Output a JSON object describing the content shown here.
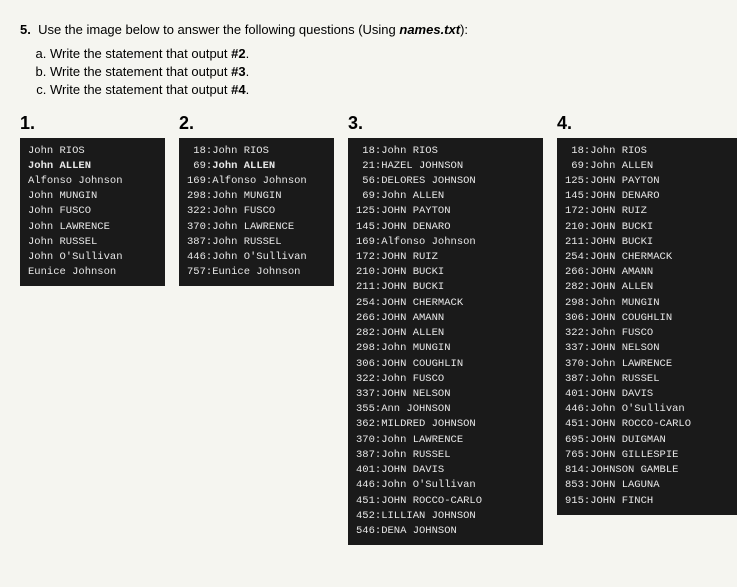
{
  "question": {
    "number": "5.",
    "text": "Use the image below to answer the following questions (Using ",
    "file_italic": "names.txt",
    "text_end": "):",
    "subquestions": [
      {
        "letter": "a.",
        "text": "Write the statement that output #2."
      },
      {
        "letter": "b.",
        "text": "Write the statement that output #3."
      },
      {
        "letter": "c.",
        "text": "Write the statement that output #4."
      }
    ]
  },
  "panels": [
    {
      "id": "panel1",
      "label": "1.",
      "lines": [
        {
          "bold": false,
          "text": "John RIOS"
        },
        {
          "bold": true,
          "text": "John ALLEN"
        },
        {
          "bold": false,
          "text": "Alfonso Johnson"
        },
        {
          "bold": false,
          "text": "John MUNGIN"
        },
        {
          "bold": false,
          "text": "John FUSCO"
        },
        {
          "bold": false,
          "text": "John LAWRENCE"
        },
        {
          "bold": false,
          "text": "John RUSSEL"
        },
        {
          "bold": false,
          "text": "John O'Sullivan"
        },
        {
          "bold": false,
          "text": "Eunice Johnson"
        }
      ]
    },
    {
      "id": "panel2",
      "label": "2.",
      "lines": [
        {
          "prefix": "18:",
          "bold": false,
          "name": "John RIOS"
        },
        {
          "prefix": "69:",
          "bold": true,
          "name": "John ALLEN"
        },
        {
          "prefix": "169:",
          "bold": false,
          "name": "Alfonso Johnson"
        },
        {
          "prefix": "298:",
          "bold": false,
          "name": "John MUNGIN"
        },
        {
          "prefix": "322:",
          "bold": false,
          "name": "John FUSCO"
        },
        {
          "prefix": "370:",
          "bold": false,
          "name": "John LAWRENCE"
        },
        {
          "prefix": "387:",
          "bold": false,
          "name": "John RUSSEL"
        },
        {
          "prefix": "446:",
          "bold": false,
          "name": "John O'Sullivan"
        },
        {
          "prefix": "757:",
          "bold": false,
          "name": "Eunice Johnson"
        }
      ]
    },
    {
      "id": "panel3",
      "label": "3.",
      "lines": [
        {
          "prefix": "18:",
          "name": "John RIOS"
        },
        {
          "prefix": "21:",
          "name": "HAZEL JOHNSON"
        },
        {
          "prefix": "56:",
          "name": "DELORES JOHNSON"
        },
        {
          "prefix": "69:",
          "name": "John ALLEN"
        },
        {
          "prefix": "125:",
          "name": "JOHN PAYTON"
        },
        {
          "prefix": "145:",
          "name": "JOHN DENARO"
        },
        {
          "prefix": "169:",
          "name": "Alfonso Johnson"
        },
        {
          "prefix": "172:",
          "name": "JOHN RUIZ"
        },
        {
          "prefix": "210:",
          "name": "JOHN BUCKI"
        },
        {
          "prefix": "211:",
          "name": "JOHN BUCKI"
        },
        {
          "prefix": "254:",
          "name": "JOHN CHERMACK"
        },
        {
          "prefix": "266:",
          "name": "JOHN AMANN"
        },
        {
          "prefix": "282:",
          "name": "JOHN ALLEN"
        },
        {
          "prefix": "298:",
          "name": "John MUNGIN"
        },
        {
          "prefix": "306:",
          "name": "JOHN COUGHLIN"
        },
        {
          "prefix": "322:",
          "name": "John FUSCO"
        },
        {
          "prefix": "337:",
          "name": "JOHN NELSON"
        },
        {
          "prefix": "355:",
          "name": "Ann JOHNSON"
        },
        {
          "prefix": "362:",
          "name": "MILDRED JOHNSON"
        },
        {
          "prefix": "370:",
          "name": "John LAWRENCE"
        },
        {
          "prefix": "387:",
          "name": "John RUSSEL"
        },
        {
          "prefix": "401:",
          "name": "JOHN DAVIS"
        },
        {
          "prefix": "446:",
          "name": "John O'Sullivan"
        },
        {
          "prefix": "451:",
          "name": "JOHN ROCCO-CARLO"
        },
        {
          "prefix": "452:",
          "name": "LILLIAN JOHNSON"
        },
        {
          "prefix": "546:",
          "name": "DENA JOHNSON"
        }
      ]
    },
    {
      "id": "panel4",
      "label": "4.",
      "lines": [
        {
          "prefix": "18:",
          "name": "John RIOS"
        },
        {
          "prefix": "69:",
          "name": "John ALLEN"
        },
        {
          "prefix": "125:",
          "name": "JOHN PAYTON"
        },
        {
          "prefix": "145:",
          "name": "JOHN DENARO"
        },
        {
          "prefix": "172:",
          "name": "JOHN RUIZ"
        },
        {
          "prefix": "210:",
          "name": "JOHN BUCKI"
        },
        {
          "prefix": "211:",
          "name": "JOHN BUCKI"
        },
        {
          "prefix": "254:",
          "name": "JOHN CHERMACK"
        },
        {
          "prefix": "266:",
          "name": "JOHN AMANN"
        },
        {
          "prefix": "282:",
          "name": "JOHN ALLEN"
        },
        {
          "prefix": "298:",
          "name": "John MUNGIN"
        },
        {
          "prefix": "306:",
          "name": "JOHN COUGHLIN"
        },
        {
          "prefix": "322:",
          "name": "John FUSCO"
        },
        {
          "prefix": "337:",
          "name": "JOHN NELSON"
        },
        {
          "prefix": "370:",
          "name": "John LAWRENCE"
        },
        {
          "prefix": "387:",
          "name": "John RUSSEL"
        },
        {
          "prefix": "401:",
          "name": "JOHN DAVIS"
        },
        {
          "prefix": "446:",
          "name": "John O'Sullivan"
        },
        {
          "prefix": "451:",
          "name": "JOHN ROCCO-CARLO"
        },
        {
          "prefix": "695:",
          "name": "JOHN DUIGMAN"
        },
        {
          "prefix": "765:",
          "name": "JOHN GILLESPIE"
        },
        {
          "prefix": "814:",
          "name": "JOHNSON GAMBLE"
        },
        {
          "prefix": "853:",
          "name": "JOHN LAGUNA"
        },
        {
          "prefix": "915:",
          "name": "JOHN FINCH"
        }
      ]
    }
  ]
}
